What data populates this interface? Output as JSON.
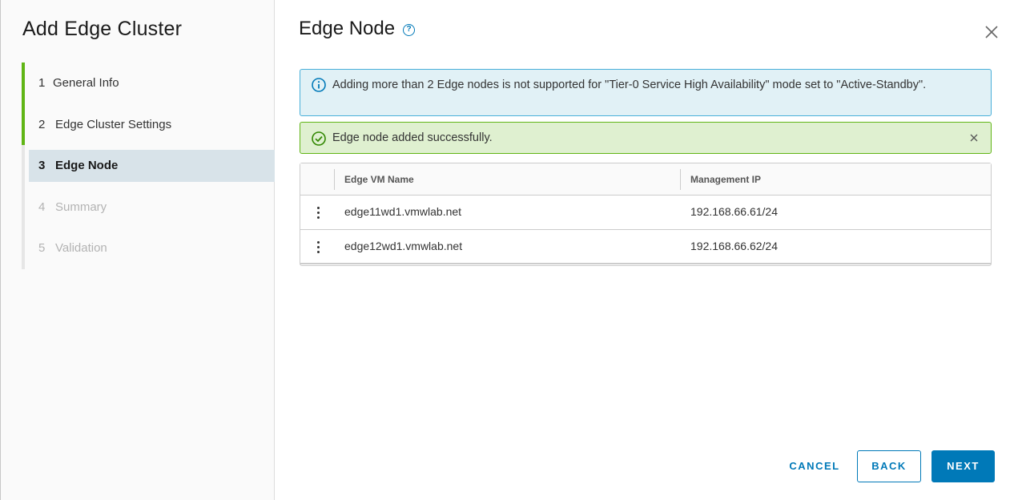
{
  "wizard": {
    "title": "Add Edge Cluster",
    "steps": [
      {
        "number": "1",
        "label": "General Info",
        "state": "done"
      },
      {
        "number": "2",
        "label": "Edge Cluster Settings",
        "state": "done"
      },
      {
        "number": "3",
        "label": "Edge Node",
        "state": "current"
      },
      {
        "number": "4",
        "label": "Summary",
        "state": "todo"
      },
      {
        "number": "5",
        "label": "Validation",
        "state": "todo"
      }
    ]
  },
  "page": {
    "title": "Edge Node",
    "help_glyph": "?"
  },
  "alerts": {
    "info_text": "Adding more than 2 Edge nodes is not supported for \"Tier-0 Service High Availability\" mode set to \"Active-Standby\".",
    "success_text": "Edge node added successfully."
  },
  "grid": {
    "columns": [
      "Edge VM Name",
      "Management IP"
    ],
    "rows": [
      {
        "name": "edge11wd1.vmwlab.net",
        "ip": "192.168.66.61/24"
      },
      {
        "name": "edge12wd1.vmwlab.net",
        "ip": "192.168.66.62/24"
      }
    ]
  },
  "footer": {
    "cancel_label": "CANCEL",
    "back_label": "BACK",
    "next_label": "NEXT"
  },
  "colors": {
    "accent": "#0079b8",
    "success": "#60b515",
    "info_bg": "#e1f1f6",
    "success_bg": "#dff0d0",
    "current_step_bg": "#d8e3e9"
  },
  "icons": {
    "info": "info-circle-icon",
    "success": "check-circle-icon",
    "close": "close-icon",
    "help": "help-icon",
    "row_menu": "vertical-ellipsis-icon"
  }
}
